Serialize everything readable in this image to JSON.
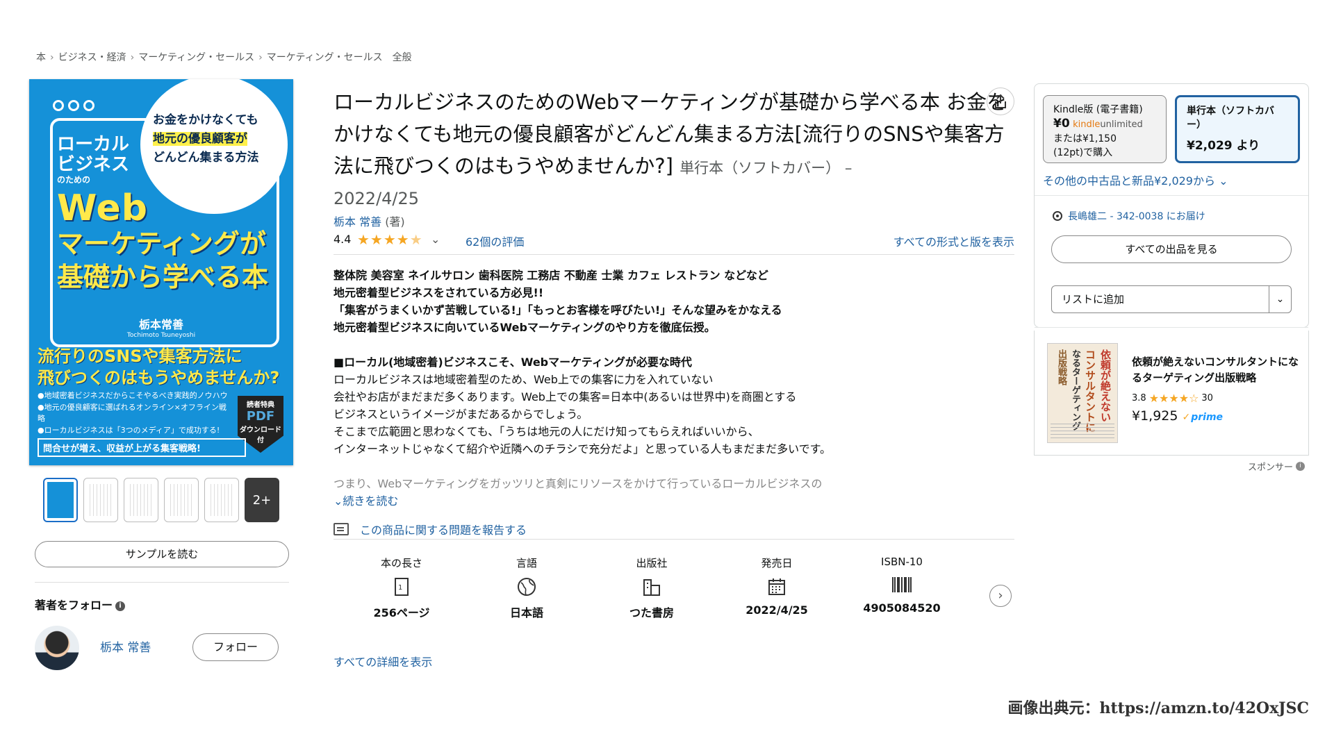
{
  "breadcrumb": [
    "本",
    "ビジネス・経済",
    "マーケティング・セールス",
    "マーケティング・セールス　全般"
  ],
  "cover": {
    "bubble_lines": [
      "お金をかけなくても",
      "地元の優良顧客が",
      "どんどん集まる方法"
    ],
    "title_top": "ローカル\nビジネス",
    "title_sub": "のための",
    "title_web": "Web",
    "title_main": "マーケティングが\n基礎から学べる本",
    "author": "栃本常善",
    "author_romaji": "Tochimoto Tsuneyoshi",
    "slogan": "流行りのSNSや集客方法に\n飛びつくのはもうやめませんか?",
    "bullets": [
      "●地域密着ビジネスだからこそやるべき実践的ノウハウ",
      "●地元の優良顧客に選ばれるオンライン×オフライン戦略",
      "●ローカルビジネスは「3つのメディア」で成功する!"
    ],
    "badge_top": "読者特典",
    "badge_pdf": "PDF",
    "badge_bottom": "ダウンロード付",
    "bottom_banner": "問合せが増え、収益が上がる集客戦略!"
  },
  "thumbs_more": "2+",
  "sample_button": "サンプルを読む",
  "follow": {
    "title": "著者をフォロー",
    "author_name": "栃本 常善",
    "button": "フォロー"
  },
  "product": {
    "title": "ローカルビジネスのためのWebマーケティングが基礎から学べる本 お金をかけなくても地元の優良顧客がどんどん集まる方法[流行りのSNSや集客方法に飛びつくのはもうやめませんか?]",
    "format": "単行本（ソフトカバー） –",
    "pub_date": "2022/4/25",
    "author": "栃本 常善",
    "author_role": "(著)",
    "rating": "4.4",
    "rating_stars": 4.4,
    "rating_count": "62個の評価",
    "all_formats": "すべての形式と版を表示"
  },
  "description": [
    {
      "text": "整体院 美容室 ネイルサロン 歯科医院 工務店 不動産 士業 カフェ レストラン などなど",
      "bold": true
    },
    {
      "text": "地元密着型ビジネスをされている方必見!!",
      "bold": true
    },
    {
      "text": "「集客がうまくいかず苦戦している!」「もっとお客様を呼びたい!」そんな望みをかなえる",
      "bold": true
    },
    {
      "text": "地元密着型ビジネスに向いているWebマーケティングのやり方を徹底伝授。",
      "bold": true
    },
    {
      "text": "",
      "bold": false
    },
    {
      "text": "■ローカル(地域密着)ビジネスこそ、Webマーケティングが必要な時代",
      "bold": true
    },
    {
      "text": "ローカルビジネスは地域密着型のため、Web上での集客に力を入れていない",
      "bold": false
    },
    {
      "text": "会社やお店がまだまだ多くあります。Web上での集客=日本中(あるいは世界中)を商圏とする",
      "bold": false
    },
    {
      "text": "ビジネスというイメージがまだあるからでしょう。",
      "bold": false
    },
    {
      "text": "そこまで広範囲と思わなくても、「うちは地元の人にだけ知ってもらえればいいから、",
      "bold": false
    },
    {
      "text": "インターネットじゃなくて紹介や近隣へのチラシで充分だよ」と思っている人もまだまだ多いです。",
      "bold": false
    },
    {
      "text": "",
      "bold": false
    },
    {
      "text": "つまり、Webマーケティングをガッツリと真剣にリソースをかけて行っているローカルビジネスの",
      "bold": false,
      "fade": true
    }
  ],
  "read_more": "続きを読む",
  "report": "この商品に関する問題を報告する",
  "details": [
    {
      "label": "本の長さ",
      "value": "256ページ",
      "icon": "page-count-icon"
    },
    {
      "label": "言語",
      "value": "日本語",
      "icon": "globe-icon"
    },
    {
      "label": "出版社",
      "value": "つた書房",
      "icon": "building-icon"
    },
    {
      "label": "発売日",
      "value": "2022/4/25",
      "icon": "calendar-icon"
    },
    {
      "label": "ISBN-10",
      "value": "4905084520",
      "icon": "barcode-icon"
    }
  ],
  "all_details": "すべての詳細を表示",
  "buybox": {
    "kindle_label": "Kindle版 (電子書籍)",
    "kindle_price": "¥0",
    "kindle_ku": "kindle",
    "kindle_ku2": "unlimited",
    "kindle_alt": "または¥1,150",
    "kindle_alt2": "(12pt)で購入",
    "paper_label": "単行本（ソフトカバー）",
    "paper_price": "¥2,029 より",
    "used_new": "その他の中古品と新品¥2,029から",
    "deliver_to": "長嶋雄二 - 342-0038 にお届け",
    "all_offers": "すべての出品を見る",
    "add_to_list": "リストに追加"
  },
  "sponsored": {
    "cover_text": [
      "依頼が絶えない",
      "コンサルタントに",
      "なるターゲティング",
      "出版戦略"
    ],
    "title": "依頼が絶えないコンサルタントになるターゲティング出版戦略",
    "rating": "3.8",
    "rating_stars": 3.8,
    "reviews": "30",
    "price": "¥1,925",
    "prime": "prime",
    "label": "スポンサー"
  },
  "credit": "画像出典元：https://amzn.to/42OxJSC",
  "colors": {
    "link": "#2162a1",
    "star": "#f5a623",
    "cover_blue": "#1591d8",
    "cover_yellow": "#ffe94a"
  }
}
